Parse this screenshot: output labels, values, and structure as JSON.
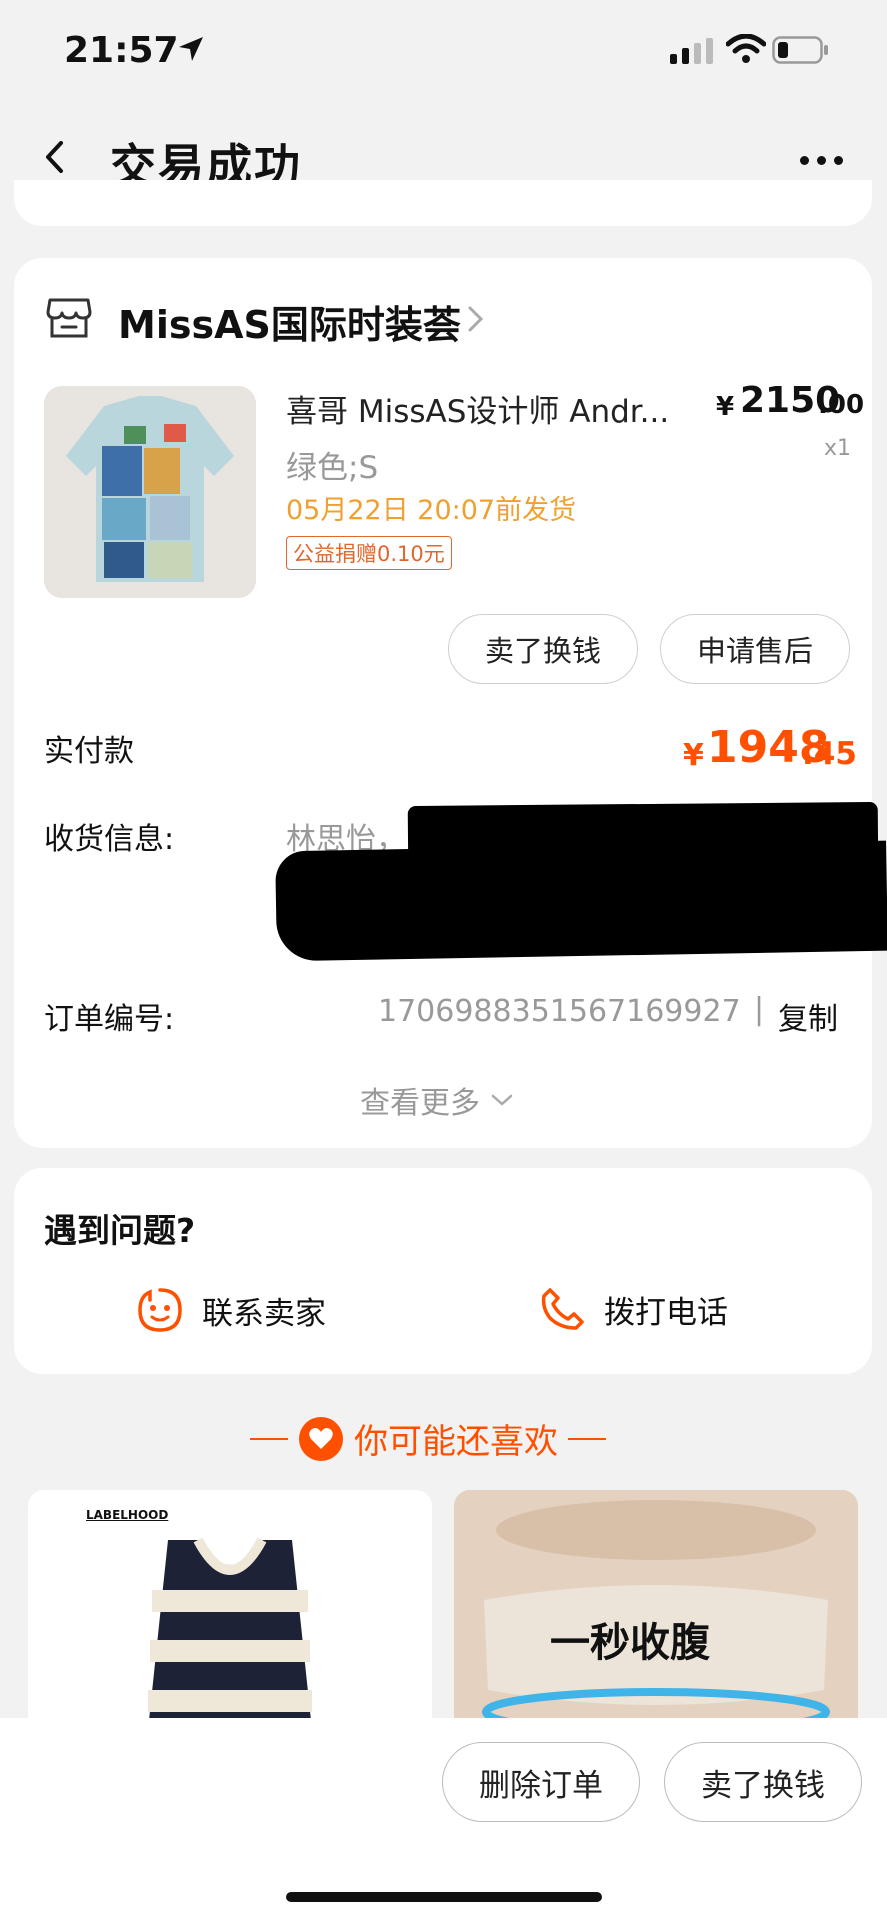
{
  "status_bar": {
    "time": "21:57"
  },
  "header": {
    "title": "交易成功"
  },
  "store": {
    "name": "MissAS国际时装荟"
  },
  "product": {
    "title": "喜哥 MissAS设计师 Andr...",
    "price_symbol": "¥",
    "price_int": "2150",
    "price_dec": ".00",
    "sku": "绿色;S",
    "qty": "x1",
    "ship_time": "05月22日 20:07前发货",
    "charity": "公益捐赠0.10元"
  },
  "actions": {
    "sell": "卖了换钱",
    "after_sale": "申请售后"
  },
  "payment": {
    "label": "实付款",
    "symbol": "¥",
    "int": "1948",
    "dec": ".45"
  },
  "address": {
    "label": "收货信息:",
    "name": "林思怡，"
  },
  "order": {
    "label": "订单编号:",
    "number": "1706988351567169927",
    "separator": "|",
    "copy": "复制"
  },
  "see_more": "查看更多",
  "issue": {
    "title": "遇到问题?",
    "contact": "联系卖家",
    "call": "拨打电话"
  },
  "recommend": {
    "title": "你可能还喜欢",
    "item1_brand": "LABELHOOD",
    "item2_text": "一秒收腹"
  },
  "bottom": {
    "delete": "删除订单",
    "sell": "卖了换钱"
  },
  "colors": {
    "accent": "#ff5000",
    "ship": "#f0a030",
    "charity": "#e2662e"
  }
}
